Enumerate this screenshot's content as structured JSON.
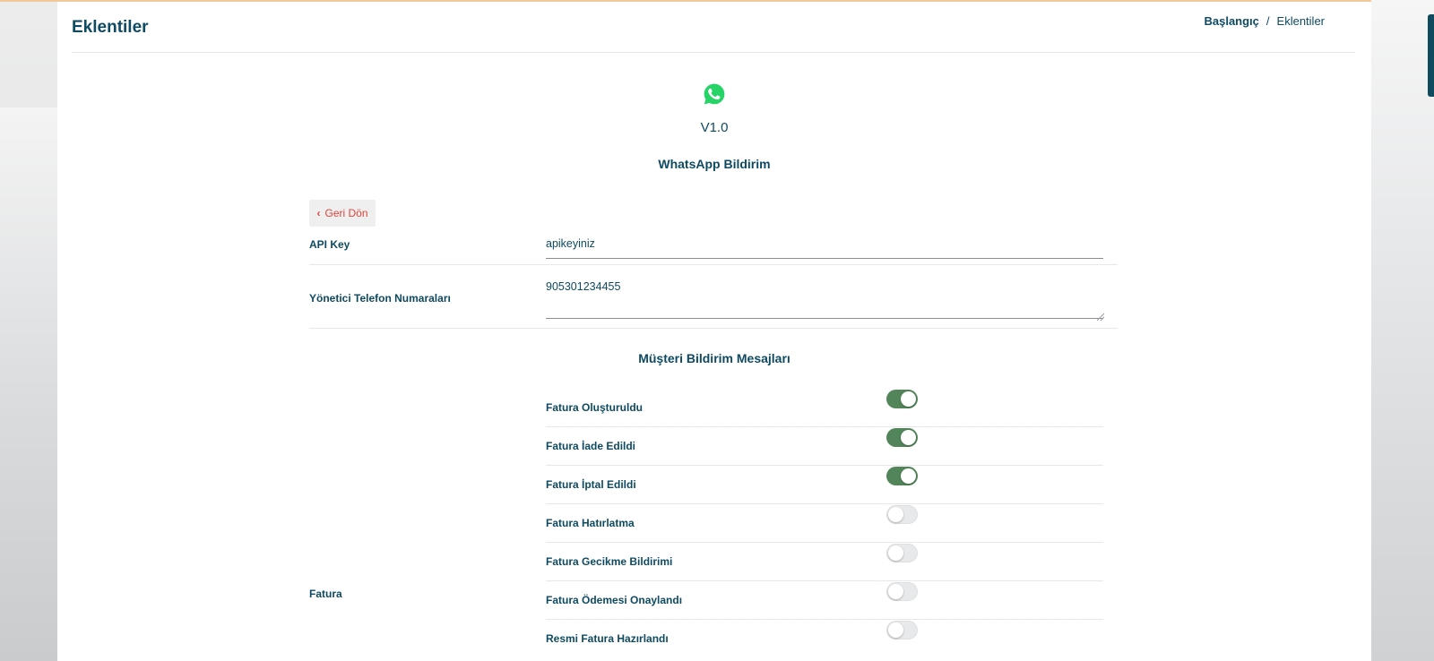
{
  "header": {
    "page_title": "Eklentiler",
    "breadcrumb": {
      "home": "Başlangıç",
      "separator": "/",
      "current": "Eklentiler"
    }
  },
  "plugin": {
    "icon": "whatsapp-icon",
    "version": "V1.0",
    "name": "WhatsApp Bildirim"
  },
  "back_button": {
    "icon": "chevron-left-icon",
    "label": "Geri Dön"
  },
  "fields": {
    "api_key": {
      "label": "API Key",
      "value": "apikeyiniz"
    },
    "admin_phones": {
      "label": "Yönetici Telefon Numaraları",
      "value": "905301234455"
    }
  },
  "customer_messages": {
    "title": "Müşteri Bildirim Mesajları",
    "groups": [
      {
        "label": "Fatura",
        "options": [
          {
            "label": "Fatura Oluşturuldu",
            "enabled": true
          },
          {
            "label": "Fatura İade Edildi",
            "enabled": true
          },
          {
            "label": "Fatura İptal Edildi",
            "enabled": true
          },
          {
            "label": "Fatura Hatırlatma",
            "enabled": false
          },
          {
            "label": "Fatura Gecikme Bildirimi",
            "enabled": false
          },
          {
            "label": "Fatura Ödemesi Onaylandı",
            "enabled": false
          },
          {
            "label": "Resmi Fatura Hazırlandı",
            "enabled": false
          }
        ]
      }
    ]
  },
  "colors": {
    "primary": "#0e4a61",
    "toggle_on": "#52855a",
    "back_text": "#e0443c",
    "whatsapp_green": "#25d366"
  }
}
